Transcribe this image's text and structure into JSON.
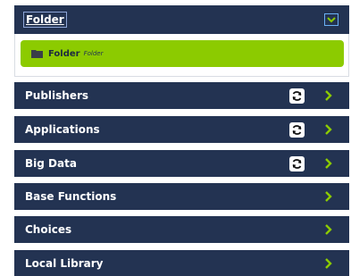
{
  "folder_panel": {
    "title": "Folder",
    "item": {
      "label": "Folder",
      "sublabel": "Folder"
    }
  },
  "rows": [
    {
      "label": "Publishers",
      "has_sync": true
    },
    {
      "label": "Applications",
      "has_sync": true
    },
    {
      "label": "Big Data",
      "has_sync": true
    },
    {
      "label": "Base Functions",
      "has_sync": false
    },
    {
      "label": "Choices",
      "has_sync": false
    },
    {
      "label": "Local Library",
      "has_sync": false
    }
  ],
  "colors": {
    "panel_bg": "#233352",
    "accent_green": "#8ccb00",
    "chevron": "#8ccb00",
    "collapse_border": "#6ab0f3"
  },
  "icons": {
    "collapse": "chevron-down-icon",
    "folder": "folder-icon",
    "sync": "sync-icon",
    "expand": "chevron-right-icon"
  }
}
